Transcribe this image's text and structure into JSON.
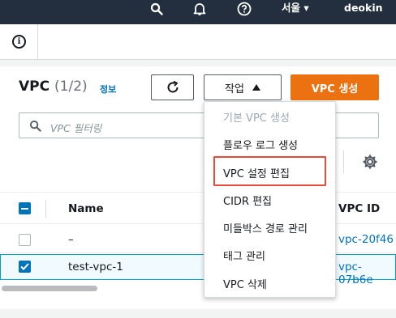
{
  "topnav": {
    "search_icon": "search-icon",
    "bell_icon": "bell-icon",
    "help_icon": "help-icon",
    "region": "서울",
    "user": "deokin"
  },
  "info_icon": "info-icon",
  "header": {
    "title": "VPC",
    "count": "(1/2)",
    "info_link": "정보",
    "actions_label": "작업",
    "create_label": "VPC 생성"
  },
  "search": {
    "placeholder": "VPC 필터링"
  },
  "table": {
    "columns": [
      "Name",
      "VPC ID"
    ],
    "rows": [
      {
        "name": "–",
        "vpc_id": "vpc-20f46",
        "selected": false
      },
      {
        "name": "test-vpc-1",
        "vpc_id": "vpc-07b6e",
        "selected": true
      }
    ]
  },
  "actions_menu": {
    "items": [
      {
        "label": "기본 VPC 생성",
        "disabled": true
      },
      {
        "label": "플로우 로그 생성",
        "disabled": false
      },
      {
        "label": "VPC 설정 편집",
        "disabled": false,
        "highlighted": true
      },
      {
        "label": "CIDR 편집",
        "disabled": false
      },
      {
        "label": "미들박스 경로 관리",
        "disabled": false
      },
      {
        "label": "태그 관리",
        "disabled": false
      },
      {
        "label": "VPC 삭제",
        "disabled": false
      }
    ]
  },
  "colors": {
    "nav_bg": "#232f3e",
    "primary": "#ec7211",
    "link": "#0073bb",
    "highlight": "#e84b3a"
  }
}
